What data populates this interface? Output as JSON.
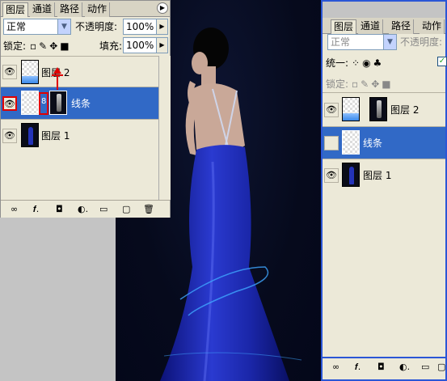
{
  "left_panel": {
    "tabs": [
      {
        "label": "图层",
        "active": true
      },
      {
        "label": "通道",
        "active": false
      },
      {
        "label": "路径",
        "active": false
      },
      {
        "label": "动作",
        "active": false
      }
    ],
    "menu_icon": "play-triangle-icon",
    "blend_mode": "正常",
    "opacity_label": "不透明度:",
    "opacity_value": "100%",
    "lock_label": "锁定:",
    "fill_label": "填充:",
    "fill_value": "100%",
    "layers": [
      {
        "name": "图层 2",
        "visible": true,
        "selected": false
      },
      {
        "name": "线条",
        "visible": true,
        "selected": true
      },
      {
        "name": "图层 1",
        "visible": true,
        "selected": false
      }
    ]
  },
  "right_panel": {
    "tabs": [
      {
        "label": "图层",
        "active": true
      },
      {
        "label": "通道",
        "active": false
      },
      {
        "label": "路径",
        "active": false
      },
      {
        "label": "动作",
        "active": false
      }
    ],
    "blend_mode": "正常",
    "opacity_label": "不透明度:",
    "unify_label": "统一:",
    "lock_label": "锁定:",
    "layers": [
      {
        "name": "图层 2",
        "visible": true,
        "selected": false
      },
      {
        "name": "线条",
        "visible": false,
        "selected": true
      },
      {
        "name": "图层 1",
        "visible": true,
        "selected": false
      }
    ]
  },
  "colors": {
    "selection": "#3169c6",
    "panel_bg": "#ece9d8",
    "highlight_red": "#e00000",
    "dress_blue": "#1f2db5"
  }
}
